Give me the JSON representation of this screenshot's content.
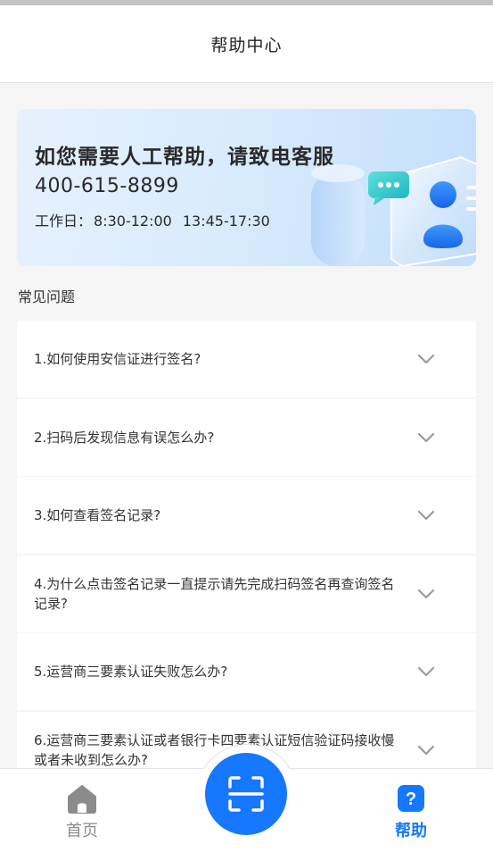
{
  "header": {
    "title": "帮助中心"
  },
  "banner": {
    "title": "如您需要人工帮助，请致电客服",
    "phone": "400-615-8899",
    "hours_label": "工作日：",
    "hours_morning": "8:30-12:00",
    "hours_afternoon": "13:45-17:30"
  },
  "faq": {
    "section_title": "常见问题",
    "items": [
      {
        "text": "1.如何使用安信证进行签名?"
      },
      {
        "text": "2.扫码后发现信息有误怎么办?"
      },
      {
        "text": "3.如何查看签名记录?"
      },
      {
        "text": "4.为什么点击签名记录一直提示请先完成扫码签名再查询签名记录?"
      },
      {
        "text": "5.运营商三要素认证失败怎么办?"
      },
      {
        "text": "6.运营商三要素认证或者银行卡四要素认证短信验证码接收慢或者未收到怎么办?"
      }
    ]
  },
  "bottom_nav": {
    "home_label": "首页",
    "help_label": "帮助",
    "home_icon": "home-icon",
    "help_icon": "question-icon",
    "scan_icon": "scan-icon"
  },
  "colors": {
    "accent": "#1677ff",
    "inactive": "#8b8b8b",
    "background": "#f5f5f5"
  }
}
